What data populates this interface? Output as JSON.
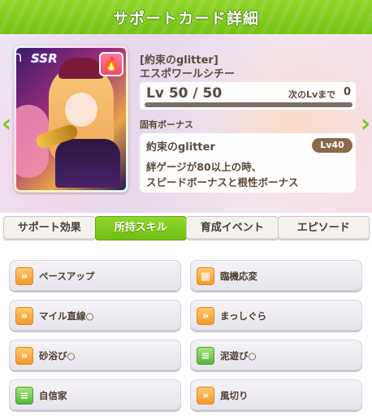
{
  "header": {
    "title": "サポートカード詳細"
  },
  "card": {
    "rarity": "SSR",
    "type_icon": "flame-icon",
    "epithet": "[約束のglitter]",
    "name": "エスポワールシチー"
  },
  "level": {
    "text": "Lv 50 / 50",
    "next_label": "次のLvまで",
    "next_value": "0",
    "progress": 1.0
  },
  "unique_bonus": {
    "section_label": "固有ボーナス",
    "name": "約束のglitter",
    "lv_badge": "Lv40",
    "desc_line1": "絆ゲージが80以上の時、",
    "desc_line2": "スピードボーナスと根性ボーナス"
  },
  "tabs": [
    {
      "label": "サポート効果",
      "active": false
    },
    {
      "label": "所持スキル",
      "active": true
    },
    {
      "label": "育成イベント",
      "active": false
    },
    {
      "label": "エピソード",
      "active": false
    }
  ],
  "skills": [
    {
      "name": "ペースアップ",
      "icon": "speed-boot-icon",
      "icon_color": "orange"
    },
    {
      "name": "臨機応変",
      "icon": "tactics-board-icon",
      "icon_color": "orange"
    },
    {
      "name": "マイル直線○",
      "icon": "speed-boot-icon",
      "icon_color": "orange"
    },
    {
      "name": "まっしぐら",
      "icon": "speed-boot-icon",
      "icon_color": "orange"
    },
    {
      "name": "砂浴び○",
      "icon": "speed-boot-icon",
      "icon_color": "orange"
    },
    {
      "name": "泥遊び○",
      "icon": "stamina-icon",
      "icon_color": "green"
    },
    {
      "name": "自信家",
      "icon": "stamina-icon",
      "icon_color": "green"
    },
    {
      "name": "風切り",
      "icon": "speed-boot-icon",
      "icon_color": "orange"
    }
  ],
  "colors": {
    "accent_green": "#74c214",
    "text_brown": "#5a4a3c"
  }
}
